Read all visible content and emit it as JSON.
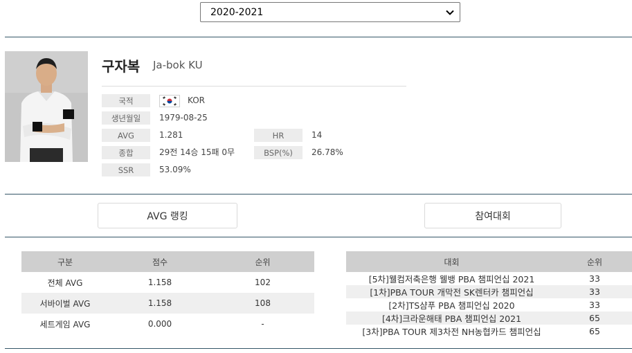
{
  "season": {
    "selected": "2020-2021"
  },
  "player": {
    "name_ko": "구자복",
    "name_en": "Ja-bok KU",
    "flag_icon": "korea-flag-icon",
    "fields": {
      "nationality": {
        "label": "국적",
        "value": "KOR"
      },
      "birth": {
        "label": "생년월일",
        "value": "1979-08-25"
      },
      "avg": {
        "label": "AVG",
        "value": "1.281"
      },
      "hr": {
        "label": "HR",
        "value": "14"
      },
      "record": {
        "label": "종합",
        "value": "29전 14승 15패 0무"
      },
      "bsp": {
        "label": "BSP(%)",
        "value": "26.78%"
      },
      "ssr": {
        "label": "SSR",
        "value": "53.09%"
      }
    }
  },
  "tabs": {
    "avg_ranking": "AVG 랭킹",
    "tournaments": "참여대회"
  },
  "avg_table": {
    "headers": [
      "구분",
      "점수",
      "순위"
    ],
    "rows": [
      [
        "전체 AVG",
        "1.158",
        "102"
      ],
      [
        "서바이벌 AVG",
        "1.158",
        "108"
      ],
      [
        "세트게임 AVG",
        "0.000",
        "-"
      ]
    ]
  },
  "tour_table": {
    "headers": [
      "대회",
      "순위"
    ],
    "rows": [
      [
        "[5차]웰컴저축은행 웰뱅 PBA 챔피언십 2021",
        "33"
      ],
      [
        "[1차]PBA TOUR 개막전 SK렌터카 챔피언십",
        "33"
      ],
      [
        "[2차]TS샴푸 PBA 챔피언십 2020",
        "33"
      ],
      [
        "[4차]크라운해태 PBA 챔피언십 2021",
        "65"
      ],
      [
        "[3차]PBA TOUR 제3차전 NH농협카드 챔피언십",
        "65"
      ]
    ]
  },
  "colors": {
    "rule": "#335566",
    "header_bg": "#cfcfcf",
    "label_bg": "#ececec"
  }
}
